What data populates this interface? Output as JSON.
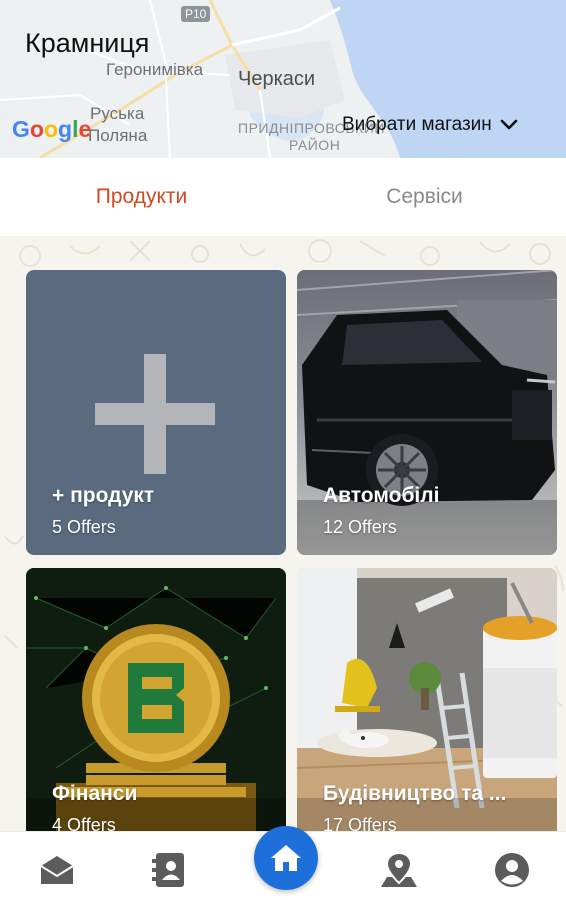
{
  "header": {
    "title": "Крамниця",
    "store_select_label": "Вибрати магазин",
    "map": {
      "road_sign": "P10",
      "labels": [
        "Геронимівка",
        "Черкаси",
        "Руська",
        "Поляна",
        "ПРИДНІПРОВСЬКИЙ",
        "РАЙОН"
      ],
      "attribution": "Google"
    }
  },
  "tabs": [
    {
      "label": "Продукти",
      "active": true
    },
    {
      "label": "Сервіси",
      "active": false
    }
  ],
  "cards": [
    {
      "title": "+ продукт",
      "subtitle": "5 Offers"
    },
    {
      "title": "Автомобілі",
      "subtitle": "12 Offers"
    },
    {
      "title": "Фінанси",
      "subtitle": "4 Offers"
    },
    {
      "title": "Будівництво та ...",
      "subtitle": "17 Offers"
    }
  ],
  "bottom_nav": {
    "items": [
      "inbox-icon",
      "contacts-book-icon",
      "home-icon",
      "location-pin-icon",
      "profile-icon"
    ],
    "active": "home-icon"
  },
  "colors": {
    "accent_tab": "#cf4a1f",
    "add_card": "#5a6b80",
    "home_button": "#1e6fd9"
  }
}
